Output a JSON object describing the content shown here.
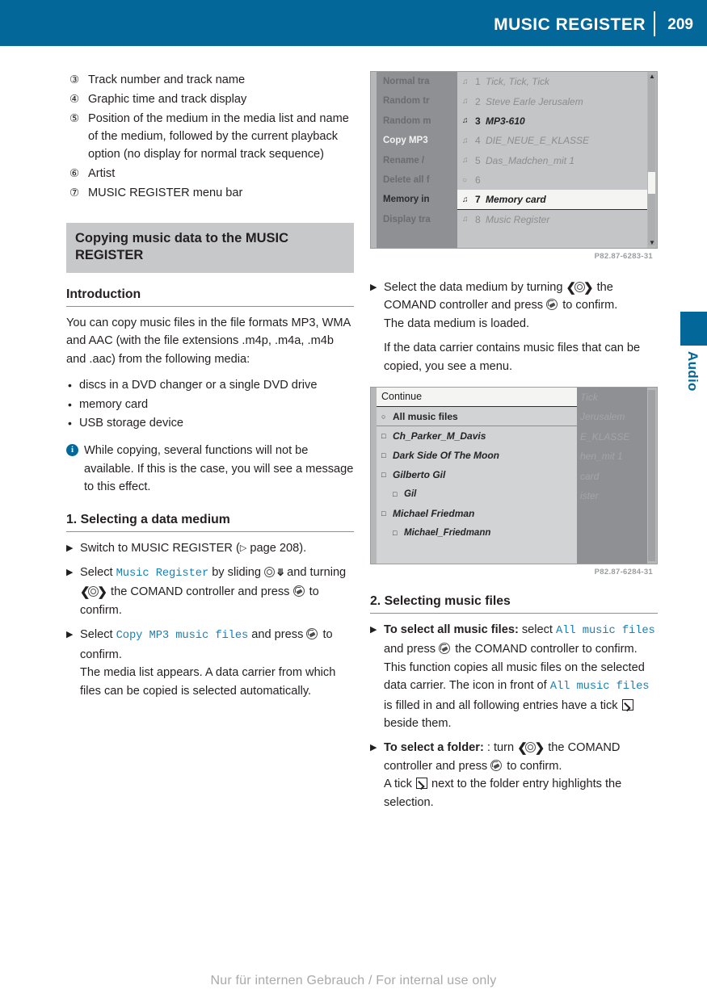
{
  "header": {
    "title": "MUSIC REGISTER",
    "page_number": "209",
    "bg_color": "#04679A"
  },
  "edge_tab": {
    "chapter_label": "Audio",
    "color": "#04679A"
  },
  "legend": {
    "items": [
      {
        "num": "③",
        "text": "Track number and track name"
      },
      {
        "num": "④",
        "text": "Graphic time and track display"
      },
      {
        "num": "⑤",
        "text": "Position of the medium in the media list and name of the medium, followed by the current playback option (no display for normal track sequence)"
      },
      {
        "num": "⑥",
        "text": "Artist"
      },
      {
        "num": "⑦",
        "text": "MUSIC REGISTER menu bar"
      }
    ]
  },
  "section": {
    "band_title": "Copying music data to the MUSIC REGISTER",
    "intro_heading": "Introduction",
    "intro_paragraph": "You can copy music files in the file formats MP3, WMA and AAC (with the file extensions .m4p, .m4a, .m4b and .aac) from the following media:",
    "media_bullets": [
      "discs in a DVD changer or a single DVD drive",
      "memory card",
      "USB storage device"
    ],
    "note_icon": "info-icon",
    "note_text": "While copying, several functions will not be available. If this is the case, you will see a message to this effect."
  },
  "step1": {
    "heading": "1. Selecting a data medium",
    "s1_a": "Switch to MUSIC REGISTER (",
    "s1_ref": "page 208",
    "s1_b": ").",
    "s2_a": "Select ",
    "s2_ui": "Music Register",
    "s2_b": " by sliding ",
    "s2_c": " and turning ",
    "s2_d": " the COMAND controller and press ",
    "s2_e": " to confirm.",
    "s3_a": "Select ",
    "s3_ui": "Copy MP3 music files",
    "s3_b": " and press ",
    "s3_c": " to confirm.",
    "s3_sub": "The media list appears. A data carrier from which files can be copied is selected automatically."
  },
  "step_right": {
    "r1_a": "Select the data medium by turning ",
    "r1_b": " the COMAND controller and press ",
    "r1_c": " to confirm.",
    "r1_sub1": "The data medium is loaded.",
    "r1_sub2": "If the data carrier contains music files that can be copied, you see a menu."
  },
  "step2": {
    "heading": "2. Selecting music files",
    "a_lead": "To select all music files:",
    "a_1": " select ",
    "a_ui": "All music files",
    "a_2": " and press ",
    "a_3": " the COMAND controller to confirm.",
    "a_sub_1": "This function copies all music files on the selected data carrier. The icon in front of ",
    "a_sub_ui": "All music files",
    "a_sub_2": " is filled in and all following entries have a tick ",
    "a_sub_3": " beside them.",
    "b_lead": "To select a folder:",
    "b_1": " : turn ",
    "b_2": " the COMAND controller and press ",
    "b_3": " to confirm.",
    "b_sub_1": "A tick ",
    "b_sub_2": " next to the folder entry highlights the selection."
  },
  "screenshot_1": {
    "caption": "P82.87-6283-31",
    "left_menu": [
      {
        "label": "Normal tra",
        "state": "faded"
      },
      {
        "label": "Random tr",
        "state": "faded"
      },
      {
        "label": "Random m",
        "state": "faded"
      },
      {
        "label": "Copy MP3",
        "state": "highlight"
      },
      {
        "label": "Rename /",
        "state": "faded"
      },
      {
        "label": "Delete all f",
        "state": "faded"
      },
      {
        "label": "Memory in",
        "state": "dark"
      },
      {
        "label": "Display tra",
        "state": "faded"
      }
    ],
    "media_list": [
      {
        "num": "1",
        "name": "Tick, Tick, Tick",
        "icon": "disc-icon",
        "state": "faded"
      },
      {
        "num": "2",
        "name": "Steve Earle   Jerusalem",
        "icon": "disc-icon",
        "state": "faded"
      },
      {
        "num": "3",
        "name": "MP3-610",
        "icon": "mp3-disc-icon",
        "state": "bold"
      },
      {
        "num": "4",
        "name": "DIE_NEUE_E_KLASSE",
        "icon": "mp3-disc-icon",
        "state": "faded"
      },
      {
        "num": "5",
        "name": "Das_Madchen_mit 1",
        "icon": "mp3-disc-icon",
        "state": "faded"
      },
      {
        "num": "6",
        "name": "",
        "icon": "empty-icon",
        "state": "faded"
      },
      {
        "num": "7",
        "name": "Memory card",
        "icon": "card-icon",
        "state": "selected"
      },
      {
        "num": "8",
        "name": "Music Register",
        "icon": "register-icon",
        "state": "faded"
      }
    ]
  },
  "screenshot_2": {
    "caption": "P82.87-6284-31",
    "continue_label": "Continue",
    "folders": [
      {
        "label": "All music files",
        "box": "radio",
        "indent": 0
      },
      {
        "label": "Ch_Parker_M_Davis",
        "box": "checkbox",
        "indent": 0
      },
      {
        "label": "Dark Side Of The Moon",
        "box": "checkbox",
        "indent": 0
      },
      {
        "label": "Gilberto Gil",
        "box": "checkbox",
        "indent": 0
      },
      {
        "label": "Gil",
        "box": "checkbox",
        "indent": 1
      },
      {
        "label": "Michael Friedman",
        "box": "checkbox",
        "indent": 0
      },
      {
        "label": "Michael_Friedmann",
        "box": "checkbox",
        "indent": 1
      }
    ],
    "ghost_text": [
      "Tick",
      "Jerusalem",
      "",
      "E_KLASSE",
      "hen_mit 1",
      "",
      "card",
      "ister"
    ]
  },
  "footer": {
    "watermark": "Nur für internen Gebrauch / For internal use only"
  }
}
